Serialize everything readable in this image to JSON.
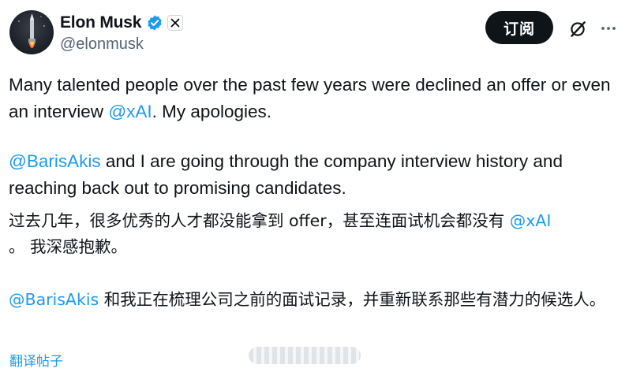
{
  "author": {
    "name": "Elon Musk",
    "handle": "@elonmusk",
    "avatar_icon": "rocket-avatar",
    "verified_color": "#1d9bf0"
  },
  "actions": {
    "subscribe_label": "订阅",
    "grok_icon": "grok-icon",
    "more_icon": "more-icon"
  },
  "tweet": {
    "p1_part1": "Many talented people over the past few years were declined an offer or even an interview ",
    "p1_mention": "@xAI",
    "p1_part2": ". My apologies.",
    "p2_mention": "@BarisAkis",
    "p2_rest": " and I are going through the company interview history and reaching back out to promising candidates.",
    "p3_part1": "过去几年，很多优秀的人才都没能拿到 offer，甚至连面试机会都没有 ",
    "p3_mention": "@xAI",
    "p3_part2": "。 我深感抱歉。",
    "p4_lead": " ",
    "p4_mention": "@BarisAkis",
    "p4_rest": " 和我正在梳理公司之前的面试记录，并重新联系那些有潜力的候选人。"
  },
  "translate_label": "翻译帖子",
  "colors": {
    "link": "#1d9bf0",
    "text": "#0f1419",
    "secondary": "#536471"
  }
}
